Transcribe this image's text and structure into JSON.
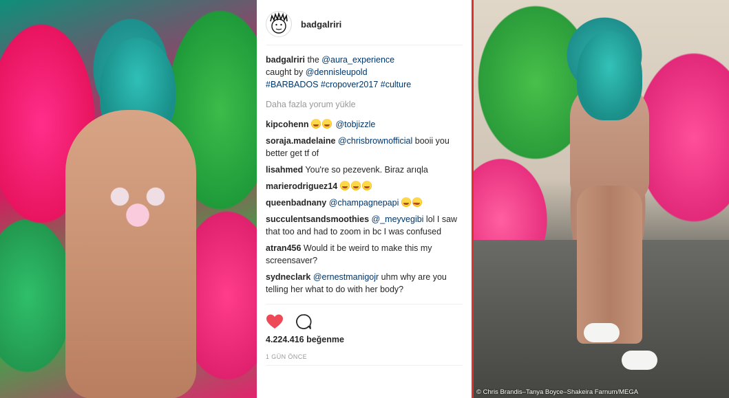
{
  "post": {
    "username": "badgalriri",
    "caption": {
      "username": "badgalriri",
      "text_1": " the ",
      "mention_1": "@aura_experience",
      "text_2": "caught by ",
      "mention_2": "@dennisleupold",
      "hashtags": "#BARBADOS #cropover2017 #culture"
    },
    "load_more": "Daha fazla yorum yükle",
    "comments": [
      {
        "username": "kipcohenn",
        "pre": "",
        "mention": "@tobjizzle",
        "text": "",
        "emojis_before": [
          "cry-laugh-emoji",
          "cry-laugh-emoji"
        ]
      },
      {
        "username": "soraja.madelaine",
        "mention": "@chrisbrownofficial",
        "text": " booii you better get tf of"
      },
      {
        "username": "lisahmed",
        "text": " You're so pezevenk. Biraz arıqla"
      },
      {
        "username": "marierodriguez14",
        "emojis": [
          "yum-emoji",
          "yum-emoji",
          "yum-emoji"
        ]
      },
      {
        "username": "queenbadnany",
        "mention": "@champagnepapi",
        "emojis": [
          "weary-emoji",
          "heart-eyes-emoji"
        ]
      },
      {
        "username": "succulentsandsmoothies",
        "mention": "@_meyvegibi",
        "text": " lol I saw that too and had to zoom in bc I was confused"
      },
      {
        "username": "atran456",
        "text": " Would it be weird to make this my screensaver?"
      },
      {
        "username": "sydneclark",
        "mention": "@ernestmanigojr",
        "text": " uhm why are you telling her what to do with her body?"
      }
    ],
    "likes": "4.224.416 beğenme",
    "timestamp": "1 GÜN ÖNCE",
    "like_color": "#ed4956"
  },
  "photo_credit": "© Chris Brandis–Tanya Boyce–Shakeira Farnum/MEGA",
  "divider_color": "#e0302b"
}
